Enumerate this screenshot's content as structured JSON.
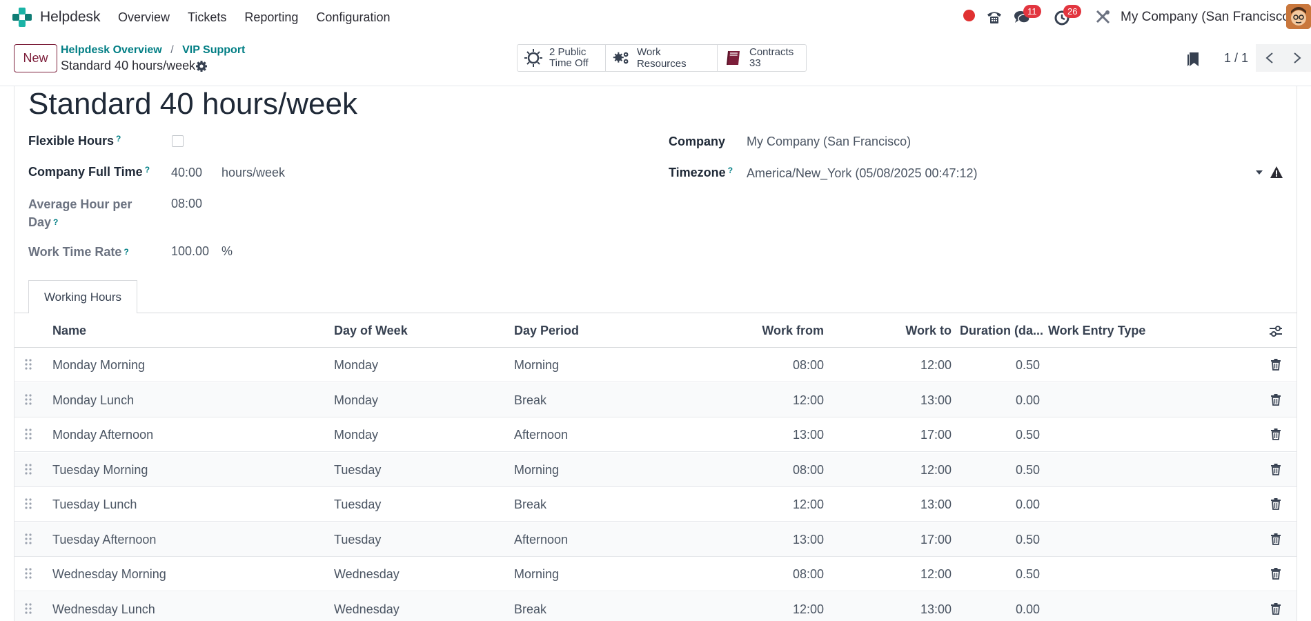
{
  "navbar": {
    "app_name": "Helpdesk",
    "menu": [
      "Overview",
      "Tickets",
      "Reporting",
      "Configuration"
    ],
    "messages_badge": "11",
    "activities_badge": "26",
    "company": "My Company (San Francisco)"
  },
  "control_panel": {
    "new_label": "New",
    "breadcrumb": [
      "Helpdesk Overview",
      "VIP Support"
    ],
    "record_name": "Standard 40 hours/week",
    "smart_buttons": {
      "public_time_off_line1": "2 Public",
      "public_time_off_line2": "Time Off",
      "work_resources": "Work Resources",
      "contracts_label": "Contracts",
      "contracts_count": "33"
    },
    "pager": "1 / 1"
  },
  "form": {
    "title": "Standard 40 hours/week",
    "flexible_hours_label": "Flexible Hours",
    "flexible_hours_checked": false,
    "full_time_label": "Company Full Time",
    "full_time_value": "40:00",
    "full_time_unit": "hours/week",
    "avg_hour_label_1": "Average Hour per",
    "avg_hour_label_2": "Day",
    "avg_hour_value": "08:00",
    "work_rate_label": "Work Time Rate",
    "work_rate_value": "100.00",
    "work_rate_unit": "%",
    "company_label": "Company",
    "company_value": "My Company (San Francisco)",
    "timezone_label": "Timezone",
    "timezone_value": "America/New_York (05/08/2025 00:47:12)",
    "help_mark": "?"
  },
  "tabs": {
    "working_hours": "Working Hours"
  },
  "table": {
    "headers": {
      "name": "Name",
      "day_of_week": "Day of Week",
      "day_period": "Day Period",
      "work_from": "Work from",
      "work_to": "Work to",
      "duration": "Duration (da...",
      "work_entry_type": "Work Entry Type"
    },
    "rows": [
      {
        "name": "Monday Morning",
        "day": "Monday",
        "period": "Morning",
        "from": "08:00",
        "to": "12:00",
        "duration": "0.50"
      },
      {
        "name": "Monday Lunch",
        "day": "Monday",
        "period": "Break",
        "from": "12:00",
        "to": "13:00",
        "duration": "0.00"
      },
      {
        "name": "Monday Afternoon",
        "day": "Monday",
        "period": "Afternoon",
        "from": "13:00",
        "to": "17:00",
        "duration": "0.50"
      },
      {
        "name": "Tuesday Morning",
        "day": "Tuesday",
        "period": "Morning",
        "from": "08:00",
        "to": "12:00",
        "duration": "0.50"
      },
      {
        "name": "Tuesday Lunch",
        "day": "Tuesday",
        "period": "Break",
        "from": "12:00",
        "to": "13:00",
        "duration": "0.00"
      },
      {
        "name": "Tuesday Afternoon",
        "day": "Tuesday",
        "period": "Afternoon",
        "from": "13:00",
        "to": "17:00",
        "duration": "0.50"
      },
      {
        "name": "Wednesday Morning",
        "day": "Wednesday",
        "period": "Morning",
        "from": "08:00",
        "to": "12:00",
        "duration": "0.50"
      },
      {
        "name": "Wednesday Lunch",
        "day": "Wednesday",
        "period": "Break",
        "from": "12:00",
        "to": "13:00",
        "duration": "0.00"
      }
    ]
  },
  "colors": {
    "brand": "#7c1e3a",
    "link": "#017e84",
    "badge": "#e2353f",
    "record_dot": "#e03131"
  },
  "icons": [
    "helpdesk-logo-icon",
    "record-dot-icon",
    "phone-icon",
    "chat-icon",
    "clock-icon",
    "tools-icon",
    "gear-icon",
    "sun-icon",
    "gears-icon",
    "book-icon",
    "bookmark-icon",
    "chevron-left-icon",
    "chevron-right-icon",
    "caret-down-icon",
    "warning-icon",
    "optional-columns-icon",
    "drag-handle-icon",
    "trash-icon"
  ]
}
